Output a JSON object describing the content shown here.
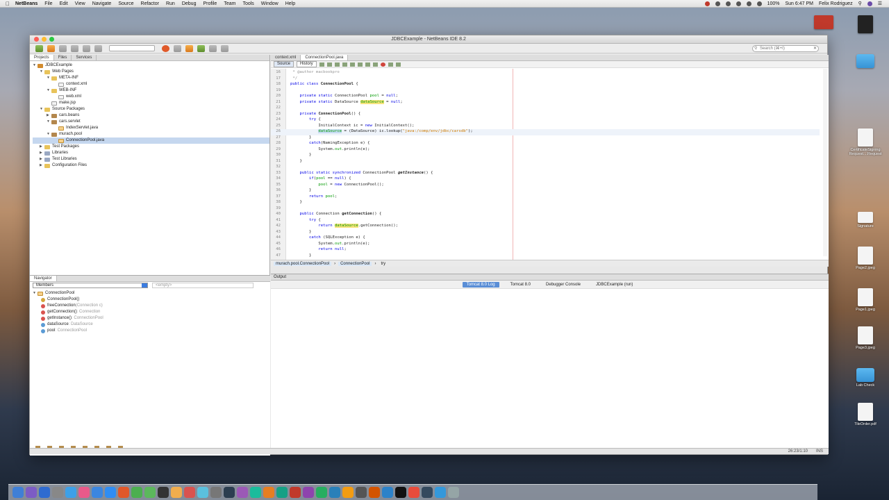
{
  "menubar": {
    "app": "NetBeans",
    "items": [
      "File",
      "Edit",
      "View",
      "Navigate",
      "Source",
      "Refactor",
      "Run",
      "Debug",
      "Profile",
      "Team",
      "Tools",
      "Window",
      "Help"
    ],
    "battery": "100%",
    "clock": "Sun 6:47 PM",
    "user": "Felix Rodriguez"
  },
  "desktop": {
    "icons": [
      "CertificateSigning Request....Request",
      "Signature",
      "Page2.jpeg",
      "Page1.jpeg",
      "Page3.jpeg",
      "Lab Check",
      "TileOrder.pdf"
    ]
  },
  "window": {
    "title": "JDBCExample - NetBeans IDE 8.2",
    "search_placeholder": "Search (⌘+I)"
  },
  "left_tabs": [
    "Projects",
    "Files",
    "Services"
  ],
  "project_tree": [
    {
      "label": "JDBCExample",
      "depth": 0,
      "icon": "proj"
    },
    {
      "label": "Web Pages",
      "depth": 1,
      "icon": "folder"
    },
    {
      "label": "META-INF",
      "depth": 2,
      "icon": "folder"
    },
    {
      "label": "context.xml",
      "depth": 3,
      "icon": "file"
    },
    {
      "label": "WEB-INF",
      "depth": 2,
      "icon": "folder"
    },
    {
      "label": "web.xml",
      "depth": 3,
      "icon": "file"
    },
    {
      "label": "make.jsp",
      "depth": 2,
      "icon": "file"
    },
    {
      "label": "Source Packages",
      "depth": 1,
      "icon": "folder"
    },
    {
      "label": "cars.beans",
      "depth": 2,
      "icon": "pkg"
    },
    {
      "label": "cars.servlet",
      "depth": 2,
      "icon": "pkg"
    },
    {
      "label": "IndexServlet.java",
      "depth": 3,
      "icon": "java"
    },
    {
      "label": "murach.pool",
      "depth": 2,
      "icon": "pkg"
    },
    {
      "label": "ConnectionPool.java",
      "depth": 3,
      "icon": "java"
    },
    {
      "label": "Test Packages",
      "depth": 1,
      "icon": "folder"
    },
    {
      "label": "Libraries",
      "depth": 1,
      "icon": "lib"
    },
    {
      "label": "Test Libraries",
      "depth": 1,
      "icon": "lib"
    },
    {
      "label": "Configuration Files",
      "depth": 1,
      "icon": "folder"
    }
  ],
  "navigator": {
    "title": "Navigator",
    "filter": "Members",
    "empty": "<empty>",
    "root": "ConnectionPool",
    "members": [
      {
        "name": "ConnectionPool()",
        "meta": ""
      },
      {
        "name": "freeConnection",
        "meta": "(Connection c)"
      },
      {
        "name": "getConnection()",
        "meta": " : Connection"
      },
      {
        "name": "getInstance()",
        "meta": " : ConnectionPool"
      },
      {
        "name": "dataSource",
        "meta": " : DataSource"
      },
      {
        "name": "pool",
        "meta": " : ConnectionPool"
      }
    ]
  },
  "editor": {
    "tabs": [
      "context.xml",
      "ConnectionPool.java"
    ],
    "source_label": "Source",
    "history_label": "History",
    "breadcrumb": [
      "murach.pool.ConnectionPool",
      "ConnectionPool",
      "try"
    ]
  },
  "output": {
    "title": "Output",
    "tabs": [
      "Tomcat 8.0 Log",
      "Tomcat 8.0",
      "Debugger Console",
      "JDBCExample (run)"
    ]
  },
  "status": {
    "position": "26:23/1:10",
    "mode": "INS"
  }
}
